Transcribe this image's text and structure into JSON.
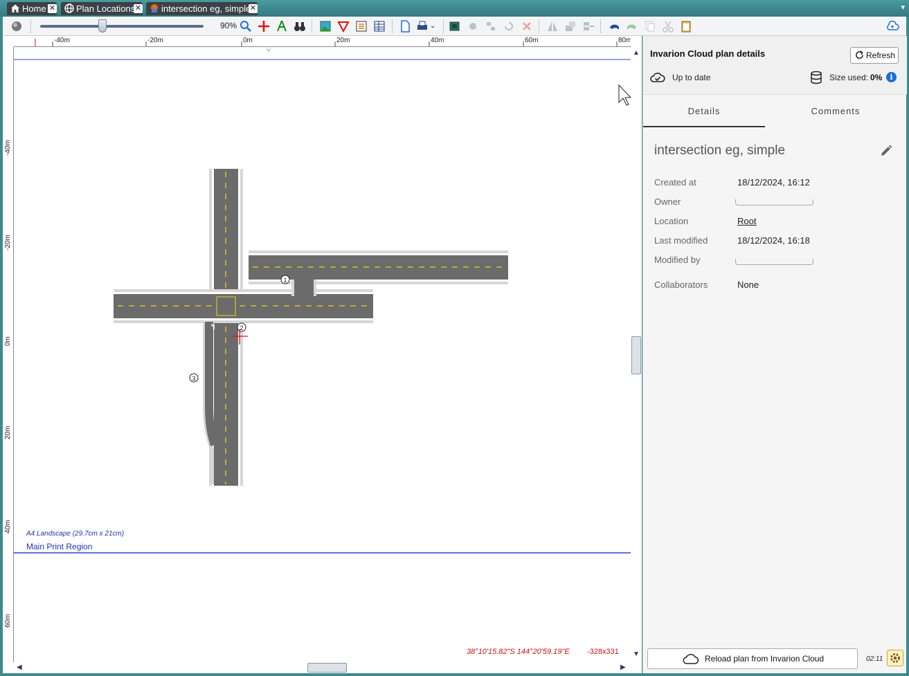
{
  "tabs": [
    {
      "label": "Home",
      "icon": "home-icon"
    },
    {
      "label": "Plan Locations",
      "icon": "globe-icon"
    },
    {
      "label": "intersection eg, simple",
      "icon": "plan-icon",
      "active": true
    }
  ],
  "toolbar": {
    "zoom_percent": "90%",
    "zoom_level": 0.38
  },
  "rulers": {
    "horizontal": [
      "-40m",
      "-20m",
      "0m",
      "20m",
      "40m",
      "60m",
      "80m"
    ],
    "vertical": [
      "-40m",
      "-20m",
      "0m",
      "20m",
      "40m",
      "60m"
    ]
  },
  "canvas": {
    "print_region_size": "A4 Landscape (29.7cm x 21cm)",
    "print_region_name": "Main Print Region",
    "coordinates": "38°10'15.82\"S 144°20'59.19\"E",
    "pixel_coords": "-328x331",
    "markers": [
      "1",
      "2",
      "3"
    ]
  },
  "panel": {
    "title": "Invarion Cloud plan details",
    "refresh_label": "Refresh",
    "sync_status": "Up to date",
    "size_label": "Size used:",
    "size_value": "0%",
    "tab_details": "Details",
    "tab_comments": "Comments",
    "plan_name": "intersection eg, simple",
    "fields": {
      "created_label": "Created at",
      "created_value": "18/12/2024, 16:12",
      "owner_label": "Owner",
      "location_label": "Location",
      "location_value": "Root",
      "modified_label": "Last modified",
      "modified_value": "18/12/2024, 16:18",
      "modified_by_label": "Modified by",
      "collaborators_label": "Collaborators",
      "collaborators_value": "None"
    },
    "reload_label": "Reload plan from Invarion Cloud",
    "clock": "02:11"
  },
  "colors": {
    "road": "#6b6b6b",
    "road_edge": "#d6d6d6",
    "lane_line": "#e8d21a",
    "print_region": "#3344cc",
    "coords_text": "#cc1111"
  }
}
